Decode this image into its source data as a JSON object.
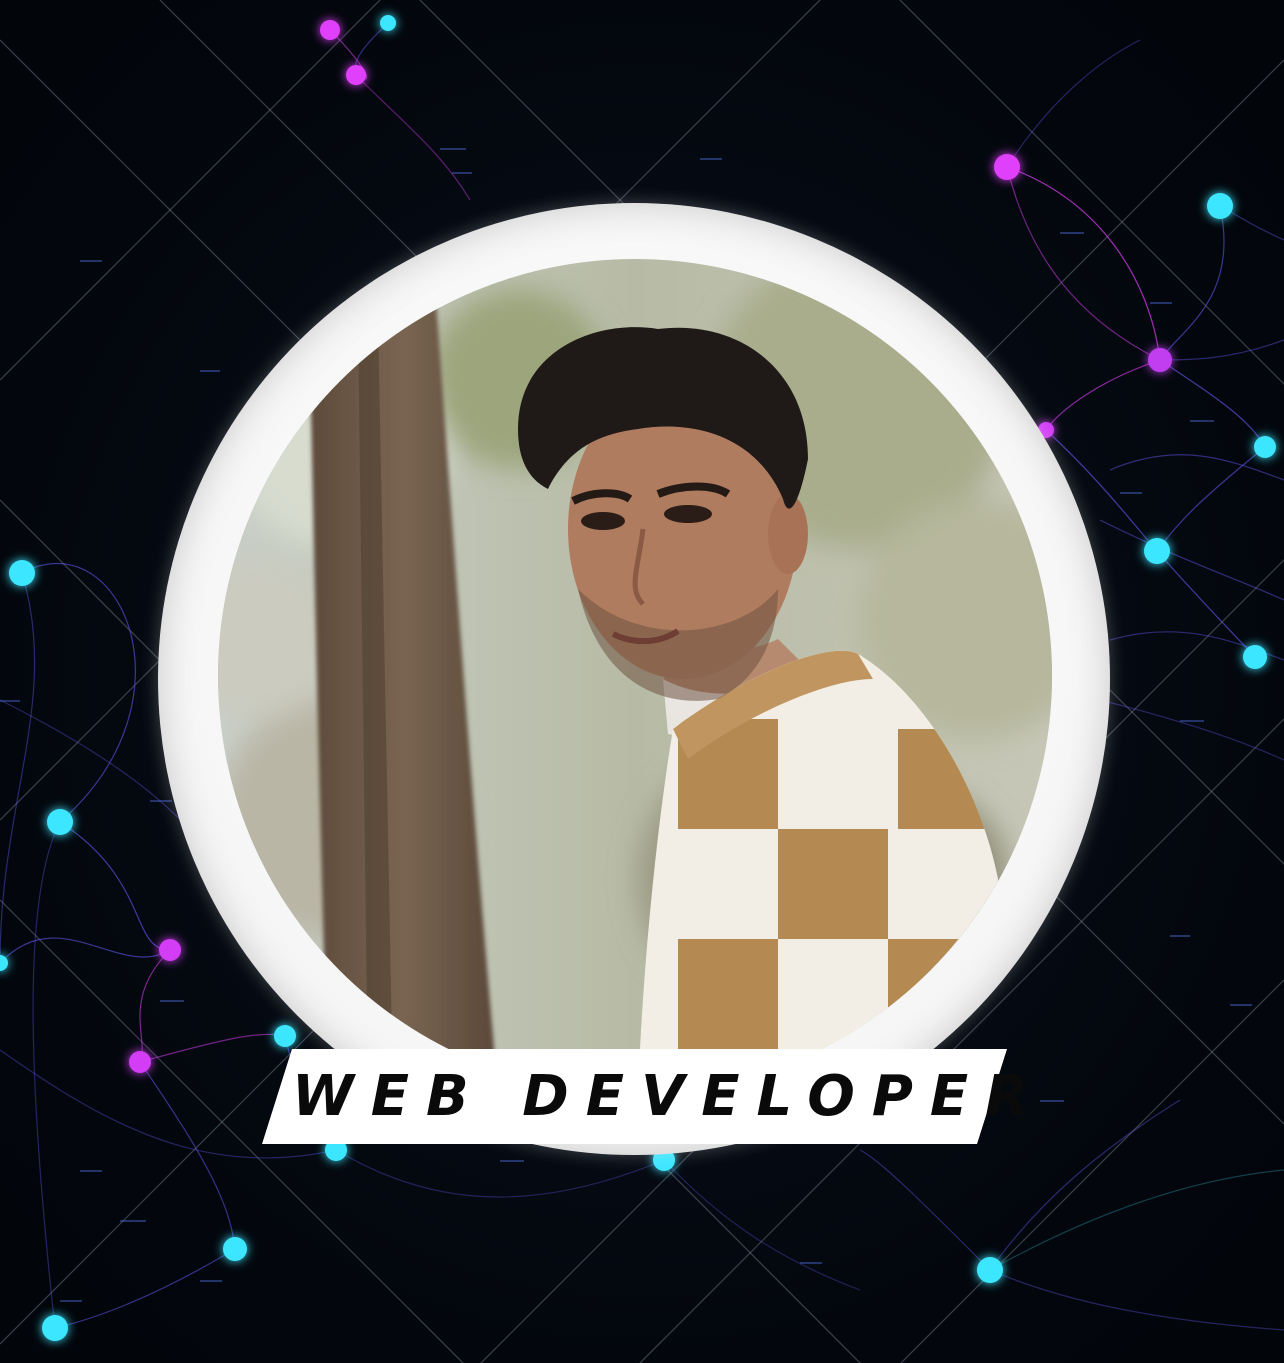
{
  "banner": {
    "title": "WEB DEVELOPER"
  },
  "colors": {
    "background": "#03080f",
    "node_cyan": "#3ee6ff",
    "node_magenta": "#e040fb",
    "link_violet": "#6a5cff",
    "frame": "#f4f4f4",
    "banner": "#ffffff",
    "banner_text": "#0a0a0a"
  },
  "icons": {
    "portrait": "person-photo",
    "background": "network-graph"
  }
}
